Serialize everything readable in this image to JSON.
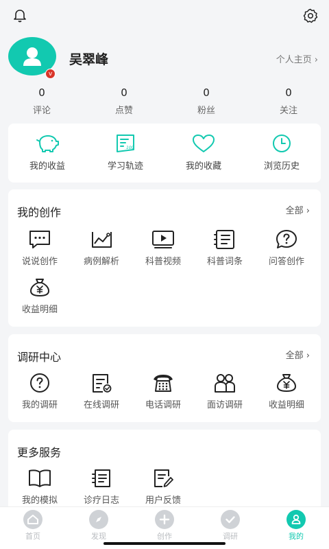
{
  "profile": {
    "name": "吴翠峰",
    "badge": "v",
    "homepage_label": "个人主页"
  },
  "stats": [
    {
      "value": "0",
      "label": "评论"
    },
    {
      "value": "0",
      "label": "点赞"
    },
    {
      "value": "0",
      "label": "粉丝"
    },
    {
      "value": "0",
      "label": "关注"
    }
  ],
  "quick": [
    {
      "label": "我的收益",
      "icon": "piggy-bank-icon"
    },
    {
      "label": "学习轨迹",
      "icon": "study-track-icon"
    },
    {
      "label": "我的收藏",
      "icon": "heart-icon"
    },
    {
      "label": "浏览历史",
      "icon": "clock-icon"
    }
  ],
  "creation": {
    "title": "我的创作",
    "all_label": "全部",
    "items": [
      {
        "label": "说说创作",
        "icon": "chat-bubble-icon"
      },
      {
        "label": "病例解析",
        "icon": "chart-analysis-icon"
      },
      {
        "label": "科普视频",
        "icon": "video-play-icon"
      },
      {
        "label": "科普词条",
        "icon": "notebook-icon"
      },
      {
        "label": "问答创作",
        "icon": "question-bubble-icon"
      },
      {
        "label": "收益明细",
        "icon": "money-bag-icon"
      }
    ]
  },
  "research": {
    "title": "调研中心",
    "all_label": "全部",
    "items": [
      {
        "label": "我的调研",
        "icon": "question-circle-icon"
      },
      {
        "label": "在线调研",
        "icon": "online-survey-icon"
      },
      {
        "label": "电话调研",
        "icon": "telephone-icon"
      },
      {
        "label": "面访调研",
        "icon": "people-icon"
      },
      {
        "label": "收益明细",
        "icon": "money-bag-icon"
      }
    ]
  },
  "services": {
    "title": "更多服务",
    "items": [
      {
        "label": "我的模拟",
        "icon": "open-book-icon"
      },
      {
        "label": "诊疗日志",
        "icon": "log-list-icon"
      },
      {
        "label": "用户反馈",
        "icon": "feedback-edit-icon"
      }
    ]
  },
  "tabs": [
    {
      "label": "首页",
      "icon": "home-icon"
    },
    {
      "label": "发现",
      "icon": "compass-icon"
    },
    {
      "label": "创作",
      "icon": "plus-icon"
    },
    {
      "label": "调研",
      "icon": "check-icon"
    },
    {
      "label": "我的",
      "icon": "user-icon"
    }
  ],
  "colors": {
    "accent": "#12c9b0",
    "badge": "#d9352a",
    "inactive_tab": "#cfd2d6"
  }
}
